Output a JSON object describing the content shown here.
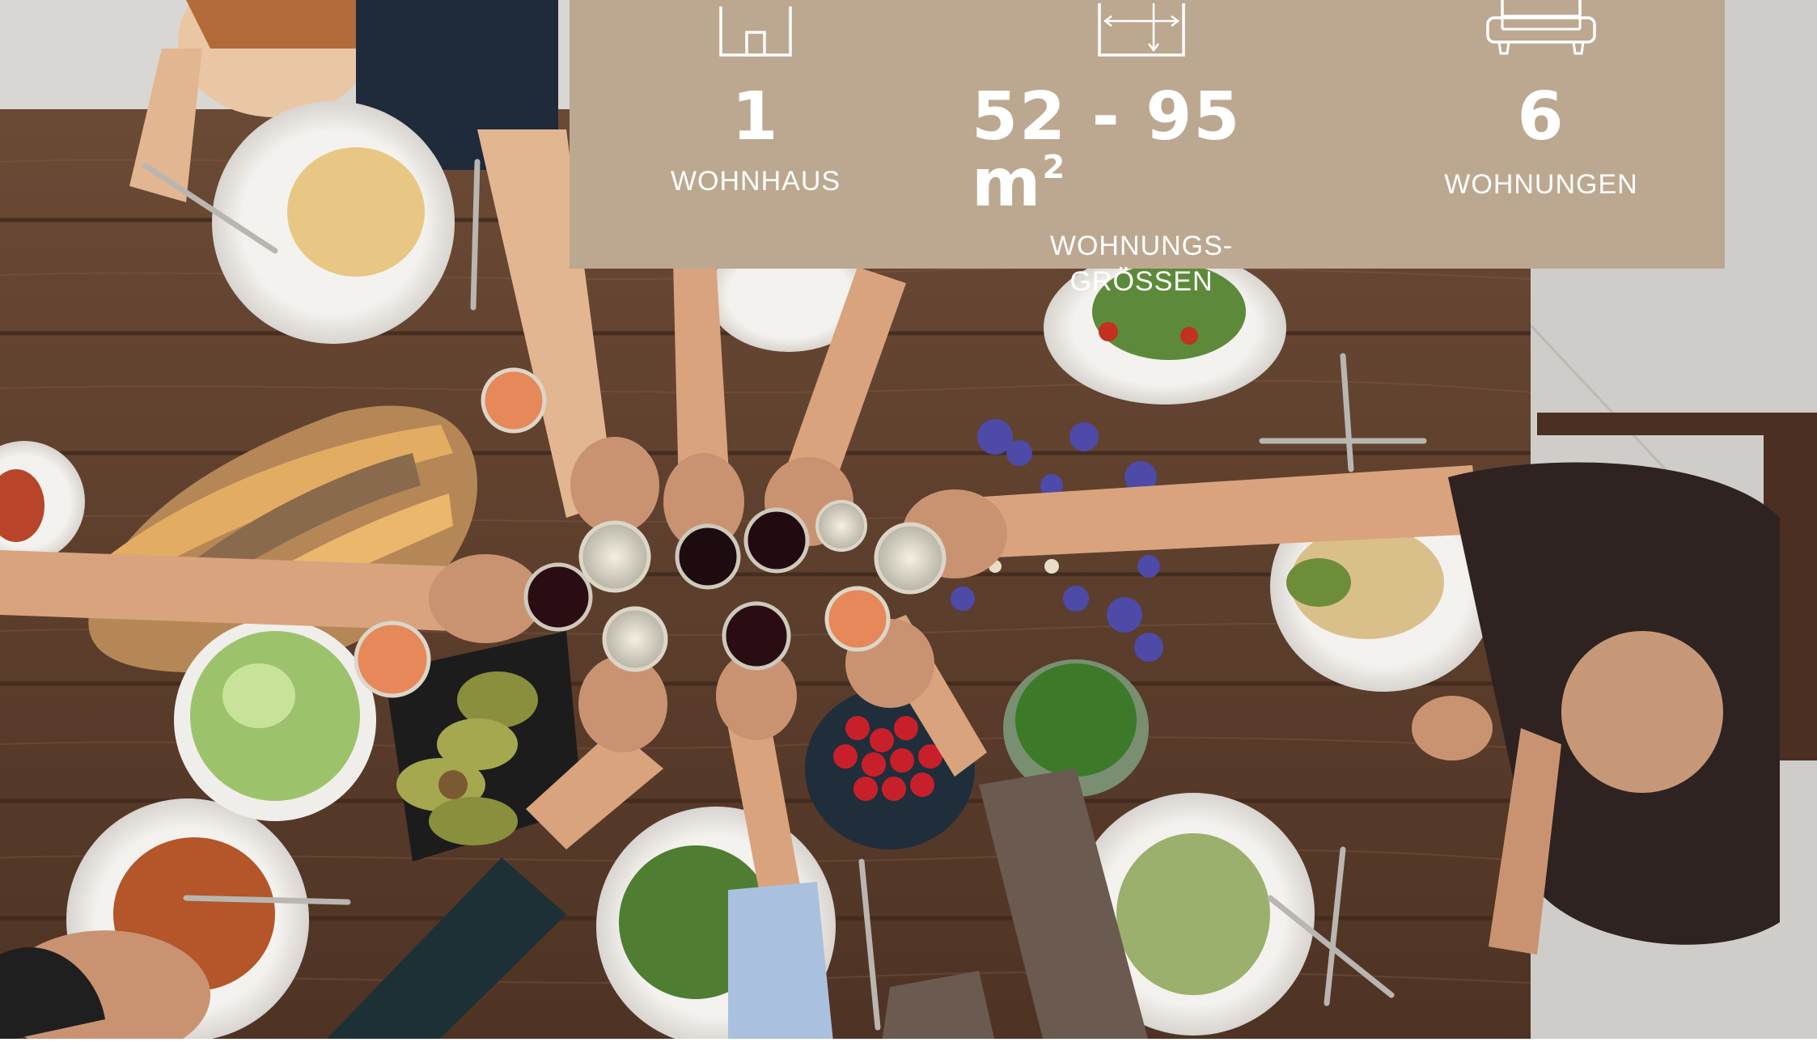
{
  "colors": {
    "panel": "#bca890",
    "panel_text": "#ffffff",
    "table_wood": "#5a3c2b",
    "floor": "#d9d7d3"
  },
  "stats": [
    {
      "icon": "house-icon",
      "value": "1",
      "label": "WOHNHAUS"
    },
    {
      "icon": "floor-plan-icon",
      "value": "52 - 95 m",
      "value_sup": "2",
      "label": "WOHNUNGS-\nGRÖSSEN"
    },
    {
      "icon": "sofa-icon",
      "value": "6",
      "label": "WOHNUNGEN"
    }
  ]
}
